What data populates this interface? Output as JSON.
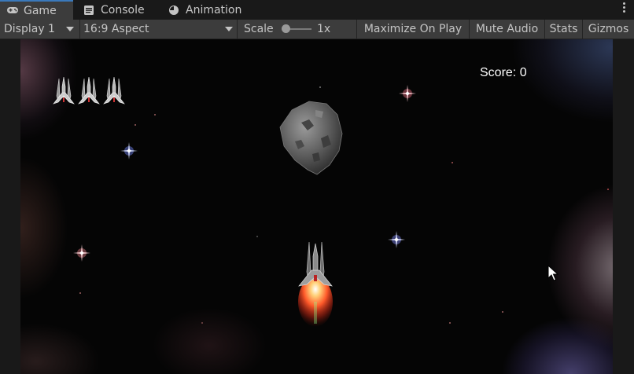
{
  "tabs": [
    {
      "label": "Game",
      "icon": "gamepad-icon",
      "active": true
    },
    {
      "label": "Console",
      "icon": "console-icon",
      "active": false
    },
    {
      "label": "Animation",
      "icon": "animation-clock-icon",
      "active": false
    }
  ],
  "toolbar": {
    "display": "Display 1",
    "aspect": "16:9 Aspect",
    "scale_label": "Scale",
    "scale_value": "1x",
    "maximize": "Maximize On Play",
    "mute": "Mute Audio",
    "stats": "Stats",
    "gizmos": "Gizmos"
  },
  "game": {
    "score_text": "Score: 0",
    "lives": 3
  },
  "colors": {
    "tab_active_accent": "#3a79bb",
    "toolbar_bg": "#3c3c3c",
    "editor_bg": "#191919",
    "exhaust": "#ff5a2a"
  }
}
